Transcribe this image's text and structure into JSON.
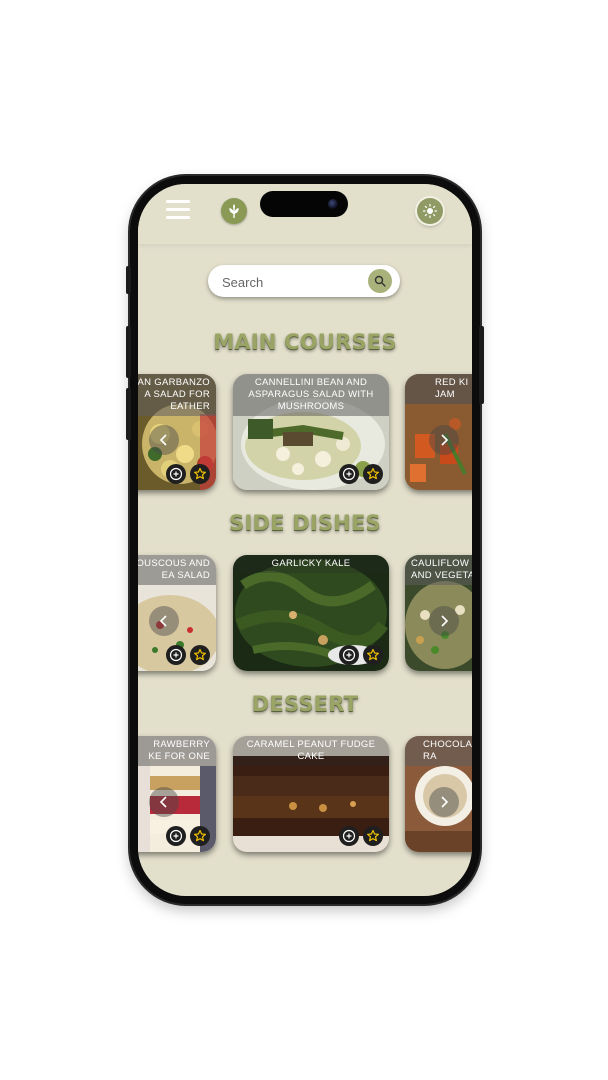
{
  "header": {
    "menu_icon": "hamburger-menu-icon",
    "logo_icon": "wheat-leaf-logo",
    "theme_icon": "sun-icon"
  },
  "search": {
    "placeholder": "Search"
  },
  "sections": [
    {
      "title": "MAIN COURSES",
      "cards": [
        {
          "title": "Tuscan Garbanzo Pasta Salad for Warm Weather",
          "visible_title": "AN GARBANZO\nA SALAD FOR\nEATHER"
        },
        {
          "title": "Cannellini Bean and Asparagus Salad with Mushrooms"
        },
        {
          "title": "Red Kidney Bean Jambalaya",
          "visible_title": "RED KI\nJAM"
        }
      ]
    },
    {
      "title": "SIDE DISHES",
      "cards": [
        {
          "title": "Couscous and Chickpea Salad",
          "visible_title": "OUSCOUS AND\nEA SALAD"
        },
        {
          "title": "Garlicky Kale"
        },
        {
          "title": "Cauliflower and Vegetable",
          "visible_title": "CAULIFLOW\nAND VEGETA"
        }
      ]
    },
    {
      "title": "DESSERT",
      "cards": [
        {
          "title": "Strawberry Cake for One",
          "visible_title": "RAWBERRY\nKE FOR ONE"
        },
        {
          "title": "Caramel Peanut Fudge Cake"
        },
        {
          "title": "Chocolate Raspberry",
          "visible_title": "CHOCOLA\nRA"
        }
      ]
    }
  ],
  "colors": {
    "background": "#e2dfcb",
    "accent": "#99a465",
    "star": "#f2c200"
  }
}
